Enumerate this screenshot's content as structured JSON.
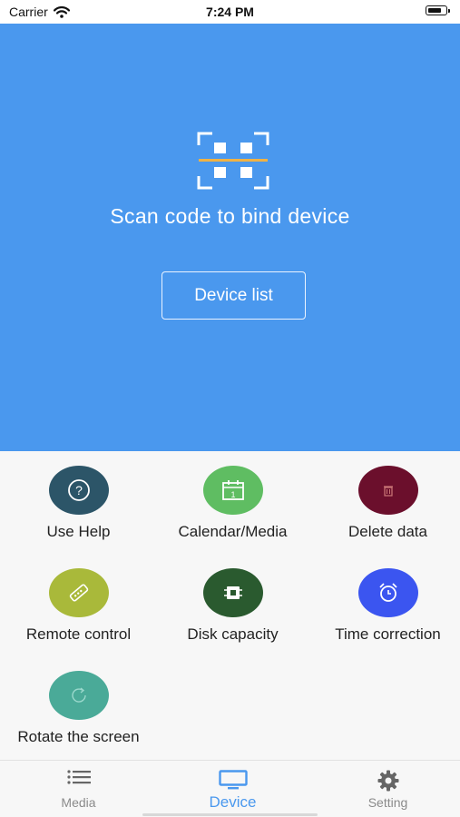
{
  "status_bar": {
    "carrier": "Carrier",
    "time": "7:24 PM",
    "battery_level": 0.8
  },
  "hero": {
    "scan_icon": "qr-scan-icon",
    "scan_text": "Scan code to bind device",
    "device_list_label": "Device list"
  },
  "functions": [
    {
      "label": "Use Help",
      "icon": "help-icon",
      "color": "#2c5568"
    },
    {
      "label": "Calendar/Media",
      "icon": "calendar-icon",
      "color": "#5fbd62"
    },
    {
      "label": "Delete data",
      "icon": "trash-icon",
      "color": "#6b0f2c"
    },
    {
      "label": "Remote control",
      "icon": "remote-icon",
      "color": "#a9b93a"
    },
    {
      "label": "Disk capacity",
      "icon": "chip-icon",
      "color": "#2a5a2f"
    },
    {
      "label": "Time correction",
      "icon": "alarm-clock-icon",
      "color": "#3b55f0"
    },
    {
      "label": "Rotate the screen",
      "icon": "rotate-icon",
      "color": "#4aaa98"
    }
  ],
  "tabbar": {
    "tabs": [
      {
        "label": "Media",
        "icon": "list-icon",
        "active": false
      },
      {
        "label": "Device",
        "icon": "monitor-icon",
        "active": true
      },
      {
        "label": "Setting",
        "icon": "gear-icon",
        "active": false
      }
    ],
    "active_color": "#4a98ee",
    "inactive_color": "#8a8a8a"
  }
}
